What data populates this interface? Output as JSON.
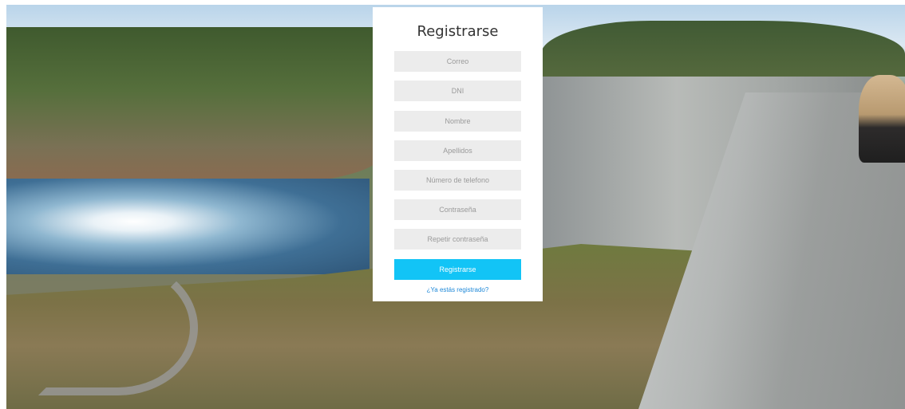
{
  "form": {
    "title": "Registrarse",
    "fields": [
      {
        "placeholder": "Correo",
        "value": ""
      },
      {
        "placeholder": "DNI",
        "value": ""
      },
      {
        "placeholder": "Nombre",
        "value": ""
      },
      {
        "placeholder": "Apellidos",
        "value": ""
      },
      {
        "placeholder": "Número de telefono",
        "value": ""
      },
      {
        "placeholder": "Contraseña",
        "value": ""
      },
      {
        "placeholder": "Repetir contraseña",
        "value": ""
      }
    ],
    "submit_label": "Registrarse",
    "login_link": "¿Ya estás registrado?"
  },
  "colors": {
    "accent": "#12c4f6",
    "link": "#1e88d8",
    "input_bg": "#ececec",
    "card_bg": "#ffffff"
  }
}
